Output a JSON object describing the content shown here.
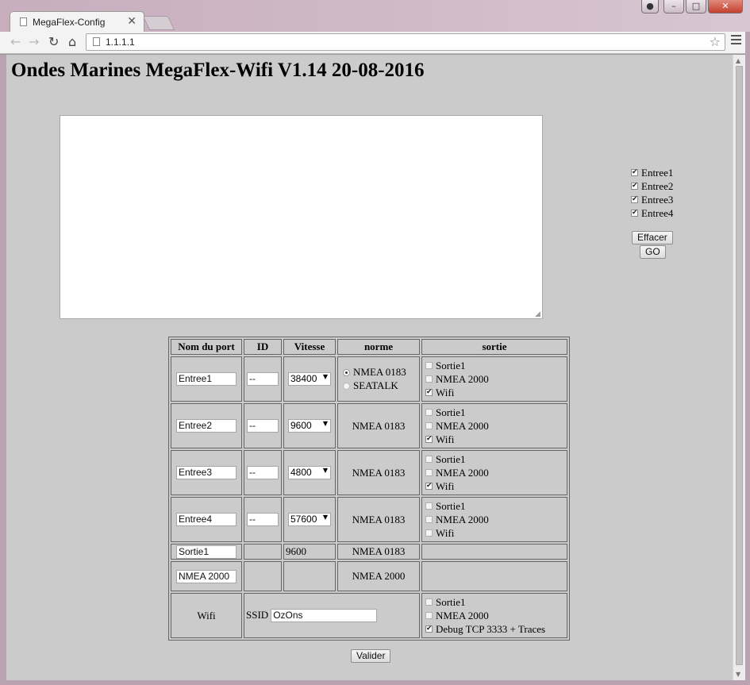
{
  "browser": {
    "tab_title": "MegaFlex-Config",
    "tab_close": "✕",
    "url": "1.1.1.1",
    "star": "☆",
    "back": "←",
    "forward": "→",
    "reload": "↻",
    "home": "⌂",
    "window_buttons": {
      "minimize": "–",
      "maximize": "□",
      "close": "✕"
    }
  },
  "page": {
    "title": "Ondes Marines MegaFlex-Wifi V1.14 20-08-2016",
    "traces_text": ""
  },
  "side_panel": {
    "entries": [
      {
        "label": "Entree1",
        "checked": true
      },
      {
        "label": "Entree2",
        "checked": true
      },
      {
        "label": "Entree3",
        "checked": true
      },
      {
        "label": "Entree4",
        "checked": true
      }
    ],
    "clear_label": "Effacer",
    "go_label": "GO"
  },
  "table": {
    "headers": [
      "Nom du port",
      "ID",
      "Vitesse",
      "norme",
      "sortie"
    ],
    "rows": [
      {
        "name": "Entree1",
        "id": "--",
        "speed": "38400",
        "norm_options": [
          "NMEA 0183",
          "SEATALK"
        ],
        "norm_selected": "NMEA 0183",
        "outputs": [
          {
            "label": "Sortie1",
            "checked": false
          },
          {
            "label": "NMEA 2000",
            "checked": false
          },
          {
            "label": "Wifi",
            "checked": true
          }
        ]
      },
      {
        "name": "Entree2",
        "id": "--",
        "speed": "9600",
        "norm": "NMEA 0183",
        "outputs": [
          {
            "label": "Sortie1",
            "checked": false
          },
          {
            "label": "NMEA 2000",
            "checked": false
          },
          {
            "label": "Wifi",
            "checked": true
          }
        ]
      },
      {
        "name": "Entree3",
        "id": "--",
        "speed": "4800",
        "norm": "NMEA 0183",
        "outputs": [
          {
            "label": "Sortie1",
            "checked": false
          },
          {
            "label": "NMEA 2000",
            "checked": false
          },
          {
            "label": "Wifi",
            "checked": true
          }
        ]
      },
      {
        "name": "Entree4",
        "id": "--",
        "speed": "57600",
        "norm": "NMEA 0183",
        "outputs": [
          {
            "label": "Sortie1",
            "checked": false
          },
          {
            "label": "NMEA 2000",
            "checked": false
          },
          {
            "label": "Wifi",
            "checked": false
          }
        ]
      }
    ],
    "sortie1": {
      "name": "Sortie1",
      "speed": "9600",
      "norm": "NMEA 0183"
    },
    "nmea2000": {
      "name": "NMEA 2000",
      "norm": "NMEA 2000"
    },
    "wifi": {
      "label": "Wifi",
      "ssid_label": "SSID",
      "ssid_value": "OzOns",
      "outputs": [
        {
          "label": "Sortie1",
          "checked": false
        },
        {
          "label": "NMEA 2000",
          "checked": false
        },
        {
          "label": "Debug TCP 3333 + Traces",
          "checked": true
        }
      ]
    }
  },
  "submit_label": "Valider",
  "icons": {
    "check": "✔",
    "select_arrow": "▼",
    "resize_grip": "◢",
    "scroll_up": "▲",
    "scroll_down": "▼"
  }
}
